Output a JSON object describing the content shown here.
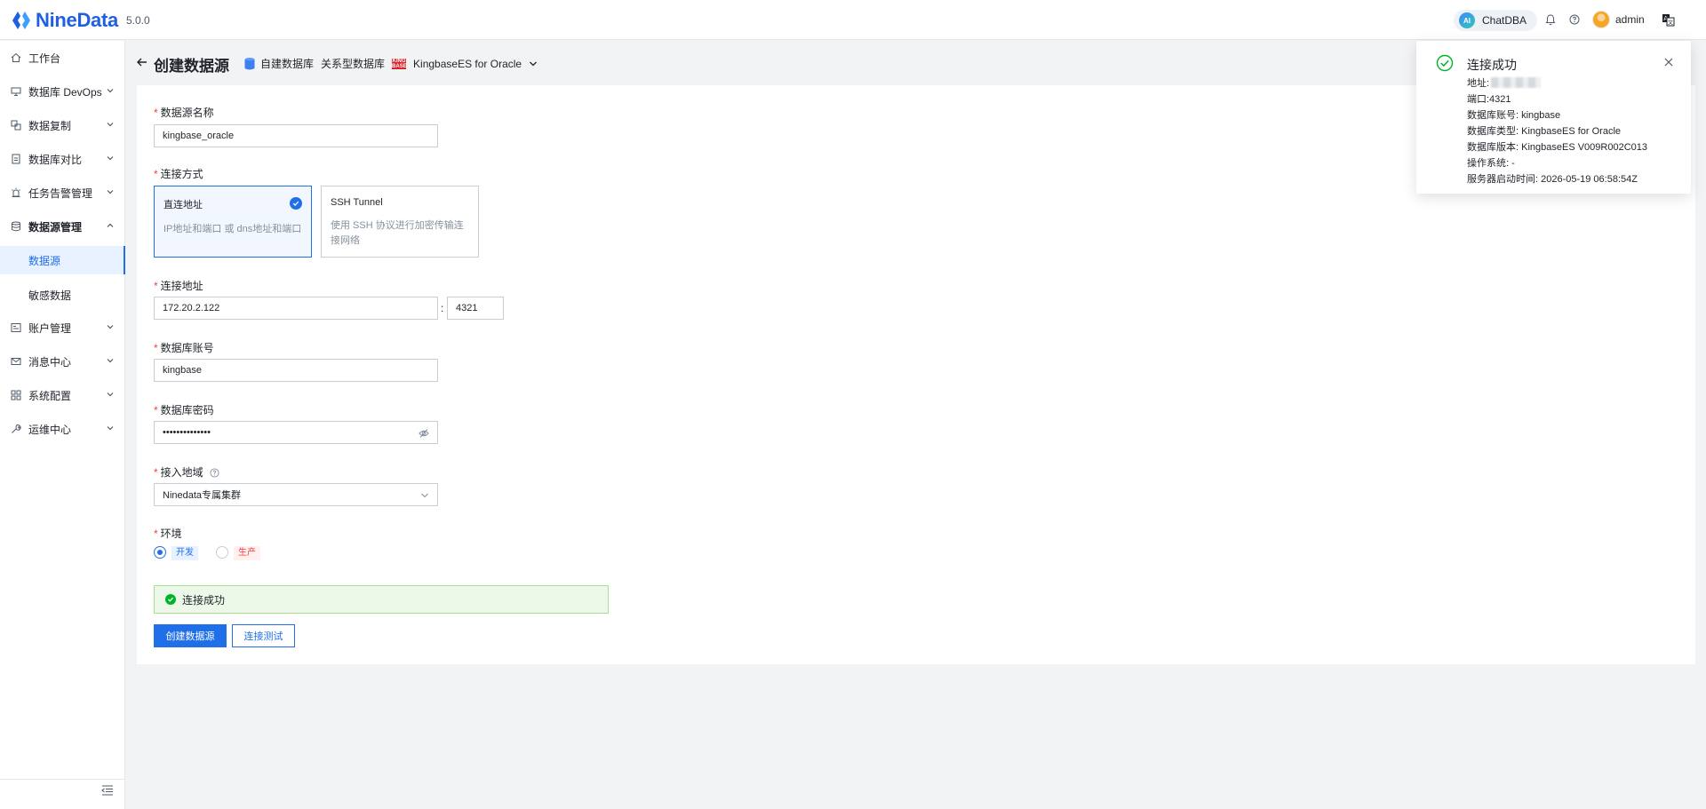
{
  "app": {
    "logo_text": "NineData",
    "version": "5.0.0"
  },
  "header": {
    "chatdba_label": "ChatDBA",
    "chatdba_badge": "AI",
    "username": "admin"
  },
  "sidebar": {
    "items": [
      {
        "label": "工作台",
        "icon": "home-icon"
      },
      {
        "label": "数据库 DevOps",
        "icon": "devops-icon"
      },
      {
        "label": "数据复制",
        "icon": "replication-icon"
      },
      {
        "label": "数据库对比",
        "icon": "compare-icon"
      },
      {
        "label": "任务告警管理",
        "icon": "alarm-icon"
      },
      {
        "label": "数据源管理",
        "icon": "datasource-icon"
      },
      {
        "label": "账户管理",
        "icon": "account-icon"
      },
      {
        "label": "消息中心",
        "icon": "mail-icon"
      },
      {
        "label": "系统配置",
        "icon": "grid-icon"
      },
      {
        "label": "运维中心",
        "icon": "wrench-icon"
      }
    ],
    "subitems": [
      {
        "label": "数据源"
      },
      {
        "label": "敏感数据"
      }
    ]
  },
  "page": {
    "title": "创建数据源",
    "breadcrumb": [
      "自建数据库",
      "关系型数据库",
      "KingbaseES for Oracle"
    ]
  },
  "form": {
    "name_label": "数据源名称",
    "name_value": "kingbase_oracle",
    "conn_mode_label": "连接方式",
    "conn_direct_title": "直连地址",
    "conn_direct_desc": "IP地址和端口 或 dns地址和端口",
    "conn_ssh_title": "SSH Tunnel",
    "conn_ssh_desc": "使用 SSH 协议进行加密传输连接网络",
    "address_label": "连接地址",
    "host_value": "172.20.2.122",
    "separator": ":",
    "port_value": "4321",
    "account_label": "数据库账号",
    "account_value": "kingbase",
    "password_label": "数据库密码",
    "password_value": "••••••••••••••",
    "region_label": "接入地域",
    "region_value": "Ninedata专属集群",
    "env_label": "环境",
    "env_dev": "开发",
    "env_prod": "生产",
    "alert_text": "连接成功",
    "submit_label": "创建数据源",
    "test_label": "连接测试"
  },
  "notification": {
    "title": "连接成功",
    "address_label": "地址:",
    "lines": [
      "端口:4321",
      "数据库账号: kingbase",
      "数据库类型: KingbaseES for Oracle",
      "数据库版本: KingbaseES V009R002C013",
      "操作系统: -",
      "服务器启动时间: 2026-05-19 06:58:54Z"
    ]
  },
  "colors": {
    "primary": "#1f6fe8",
    "success": "#00b42a",
    "danger": "#f53f3f"
  }
}
